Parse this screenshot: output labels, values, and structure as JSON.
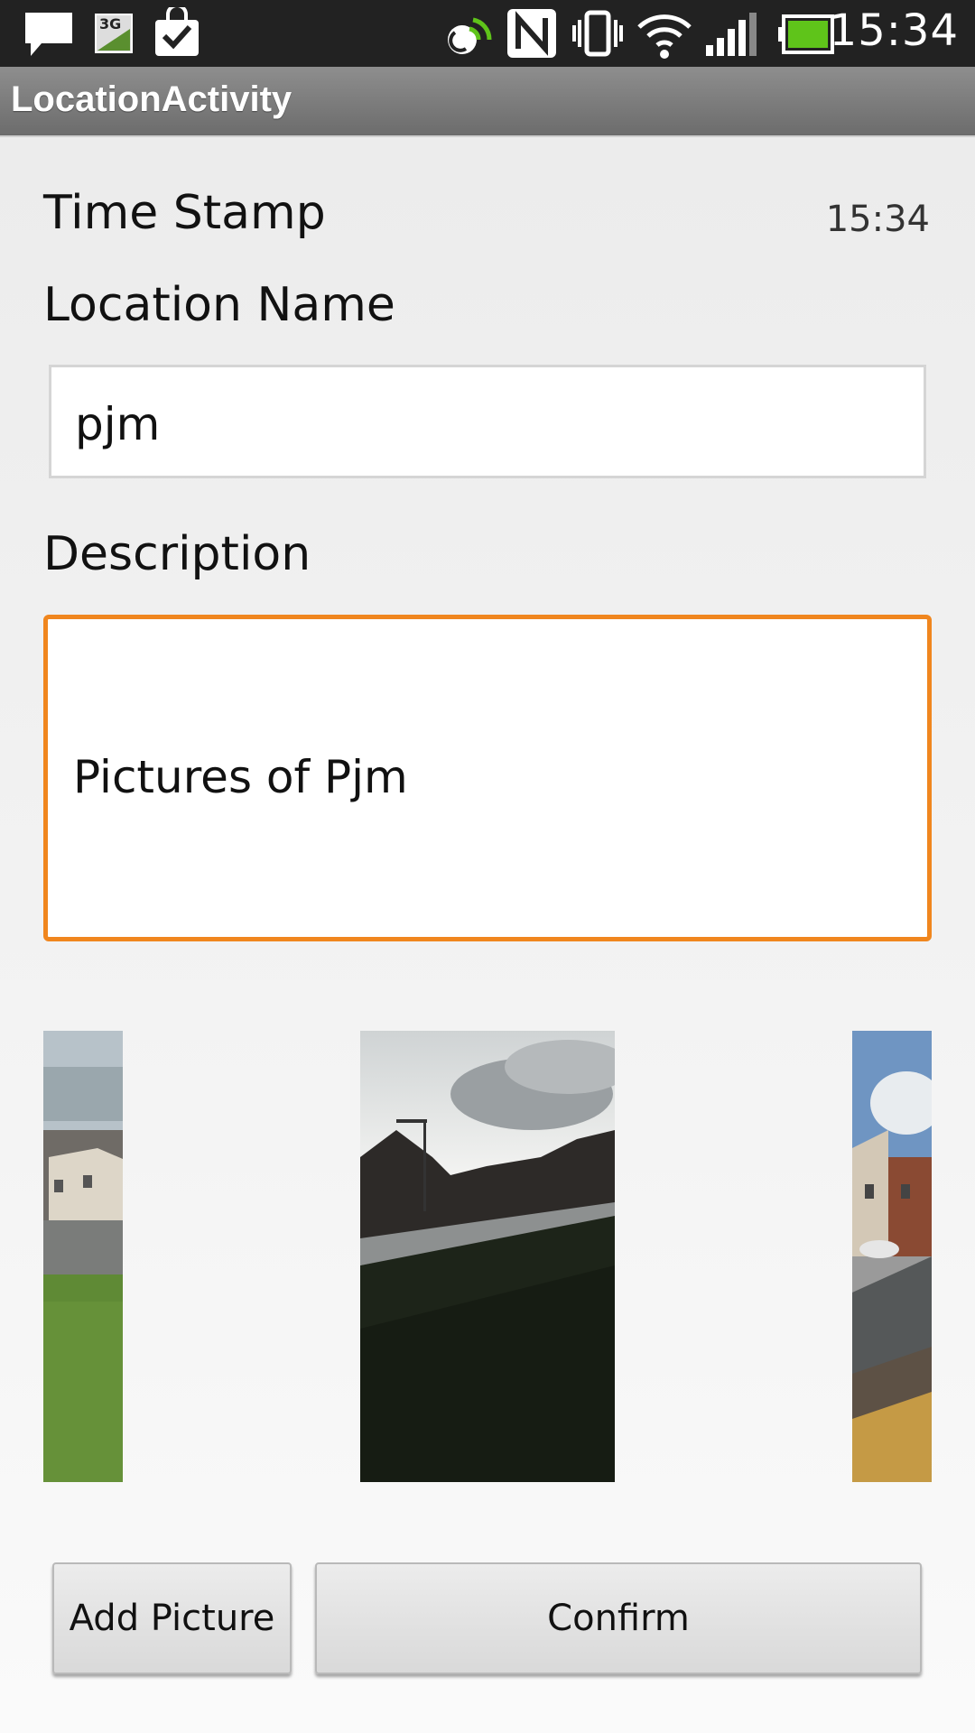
{
  "status_bar": {
    "time": "15:34",
    "icons": [
      "message-icon",
      "3g-data-icon",
      "store-check-icon",
      "nfc-beam-icon",
      "nfc-icon",
      "vibrate-icon",
      "wifi-icon",
      "signal-icon",
      "battery-icon"
    ],
    "battery_color": "#5fc41a",
    "network_label": "3G"
  },
  "app": {
    "title": "LocationActivity"
  },
  "form": {
    "timestamp_label": "Time Stamp",
    "timestamp_value": "15:34",
    "location_label": "Location Name",
    "location_value": "pjm",
    "description_label": "Description",
    "description_value": "Pictures of Pjm"
  },
  "gallery": {
    "photos": [
      "left-photo",
      "center-photo",
      "right-photo"
    ]
  },
  "buttons": {
    "add_picture": "Add Picture",
    "confirm": "Confirm"
  },
  "colors": {
    "focus_border": "#f0861e",
    "titlebar": "#7d7d7d"
  }
}
